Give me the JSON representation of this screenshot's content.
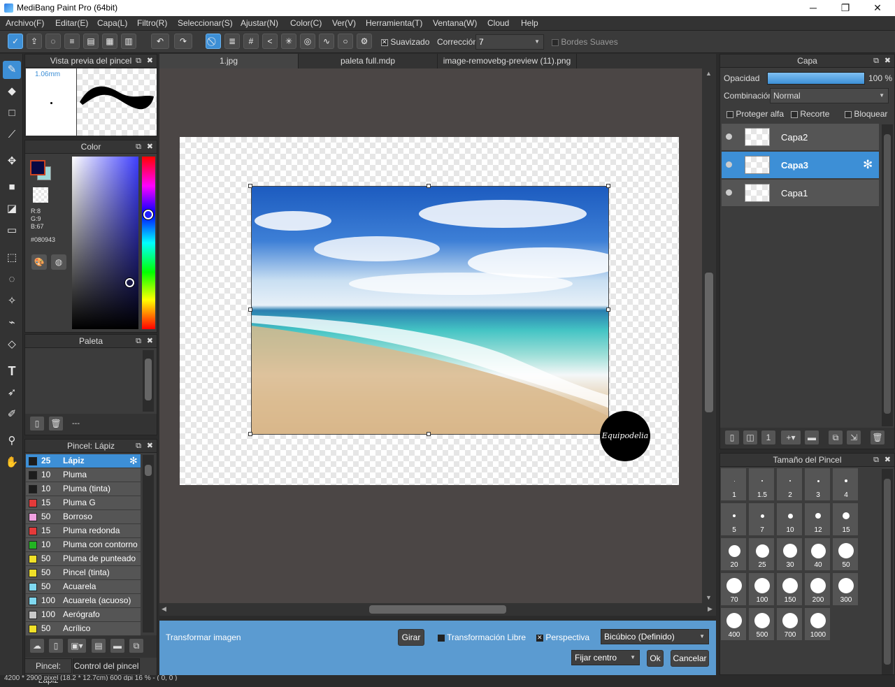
{
  "window": {
    "title": "MediBang Paint Pro (64bit)",
    "buttons": [
      "─",
      "❐",
      "✕"
    ]
  },
  "menu": [
    "Archivo(F)",
    "Editar(E)",
    "Capa(L)",
    "Filtro(R)",
    "Seleccionar(S)",
    "Ajustar(N)",
    "Color(C)",
    "Ver(V)",
    "Herramienta(T)",
    "Ventana(W)",
    "Cloud",
    "Help"
  ],
  "toolbar": {
    "suavizado_label": "Suavizado",
    "correccion_label": "Corrección",
    "correccion_value": "7",
    "bordes_label": "Bordes Suaves"
  },
  "brush_preview": {
    "title": "Vista previa del pincel",
    "size": "1.06mm"
  },
  "color_panel": {
    "title": "Color",
    "r": "R:8",
    "g": "G:9",
    "b": "B:67",
    "hex": "#080943",
    "primary": "#080943",
    "secondary": "#9ed8d8"
  },
  "palette_panel": {
    "title": "Paleta",
    "status": "---"
  },
  "brush_panel": {
    "title": "Pincel: Lápiz",
    "items": [
      {
        "size": "25",
        "name": "Lápiz",
        "color": "#1c1c1c"
      },
      {
        "size": "10",
        "name": "Pluma",
        "color": "#1c1c1c"
      },
      {
        "size": "10",
        "name": "Pluma (tinta)",
        "color": "#1c1c1c"
      },
      {
        "size": "15",
        "name": "Pluma G",
        "color": "#e53a3a"
      },
      {
        "size": "50",
        "name": "Borroso",
        "color": "#f0a0e0"
      },
      {
        "size": "15",
        "name": "Pluma redonda",
        "color": "#e53a3a"
      },
      {
        "size": "10",
        "name": "Pluma con contorno",
        "color": "#22b422"
      },
      {
        "size": "50",
        "name": "Pluma de punteado",
        "color": "#f0e028"
      },
      {
        "size": "50",
        "name": "Pincel (tinta)",
        "color": "#f0e028"
      },
      {
        "size": "50",
        "name": "Acuarela",
        "color": "#7fd8f0"
      },
      {
        "size": "100",
        "name": "Acuarela (acuoso)",
        "color": "#7fd8f0"
      },
      {
        "size": "100",
        "name": "Aerógrafo",
        "color": "#c8c8c8"
      },
      {
        "size": "50",
        "name": "Acrílico",
        "color": "#f0e028"
      }
    ],
    "tab1": "Pincel: Lápiz",
    "tab2": "Control del pincel"
  },
  "doc_tabs": [
    "1.jpg",
    "paleta full.mdp",
    "image-removebg-preview (11).png"
  ],
  "watermark": "Equipodelia",
  "transform_bar": {
    "title": "Transformar imagen",
    "rotate": "Girar",
    "free_label": "Transformación Libre",
    "perspective_label": "Perspectiva",
    "interp": "Bicúbico (Definido)",
    "anchor": "Fijar centro",
    "ok": "Ok",
    "cancel": "Cancelar"
  },
  "layer_panel": {
    "title": "Capa",
    "opacity_label": "Opacidad",
    "opacity_value": "100 %",
    "opacity_fraction": 1.0,
    "blend_label": "Combinación",
    "blend_value": "Normal",
    "protect_alpha": "Proteger alfa",
    "clip": "Recorte",
    "lock": "Bloquear",
    "layers": [
      "Capa2",
      "Capa3",
      "Capa1"
    ],
    "selected": "Capa3"
  },
  "brush_size_panel": {
    "title": "Tamaño del Pincel",
    "sizes": [
      "1",
      "1.5",
      "2",
      "3",
      "4",
      "5",
      "7",
      "10",
      "12",
      "15",
      "20",
      "25",
      "30",
      "40",
      "50",
      "70",
      "100",
      "150",
      "200",
      "300",
      "400",
      "500",
      "700",
      "1000"
    ]
  },
  "status_bar": "4200 * 2900 pixel  (18.2 * 12.7cm)  600 dpi  16 %  -  ( 0, 0 )"
}
